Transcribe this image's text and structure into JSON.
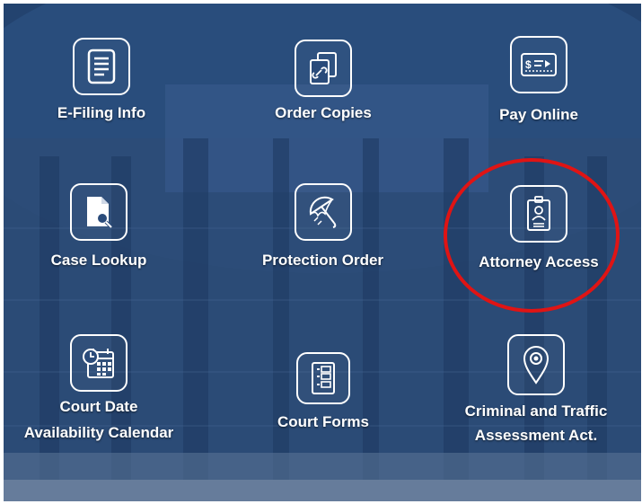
{
  "tiles": [
    {
      "label": "E-Filing Info",
      "icon": "document-icon"
    },
    {
      "label": "Order Copies",
      "icon": "copy-pages-icon"
    },
    {
      "label": "Pay Online",
      "icon": "check-payment-icon"
    },
    {
      "label": "Case Lookup",
      "icon": "file-search-icon"
    },
    {
      "label": "Protection Order",
      "icon": "umbrella-icon"
    },
    {
      "label": "Attorney Access",
      "icon": "id-badge-icon"
    },
    {
      "label_line1": "Court Date",
      "label_line2": "Availability Calendar",
      "icon": "calendar-clock-icon"
    },
    {
      "label": "Court Forms",
      "icon": "form-icon"
    },
    {
      "label_line1": "Criminal and Traffic",
      "label_line2": "Assessment Act.",
      "icon": "location-pin-icon"
    }
  ],
  "highlight": {
    "target": "Attorney Access",
    "color": "#e01414"
  },
  "colors": {
    "background": "#284b7b",
    "icon_stroke": "#ffffff"
  }
}
